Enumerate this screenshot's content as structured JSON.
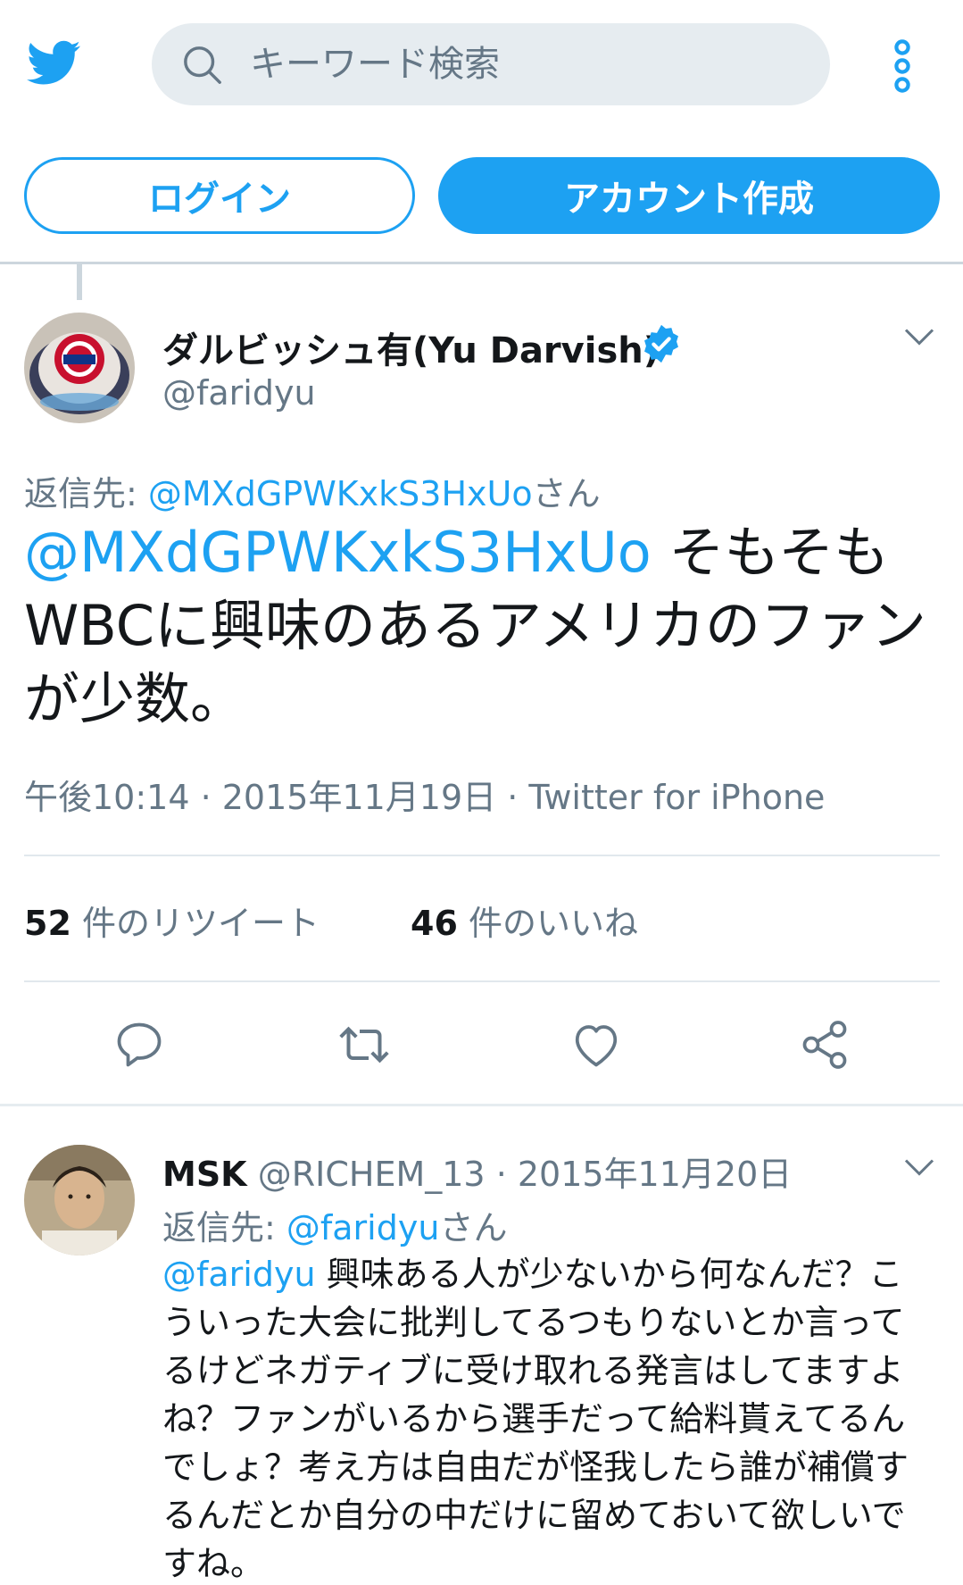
{
  "header": {
    "search_placeholder": "キーワード検索"
  },
  "auth": {
    "login_label": "ログイン",
    "signup_label": "アカウント作成"
  },
  "tweet": {
    "author_name": "ダルビッシュ有(Yu Darvish)",
    "author_handle": "@faridyu",
    "reply_to_prefix": "返信先: ",
    "reply_to_handle": "@MXdGPWKxkS3HxUo",
    "reply_to_suffix": "さん",
    "mention": "@MXdGPWKxkS3HxUo",
    "body": " そもそもWBCに興味のあるアメリカのファンが少数。",
    "timestamp": "午後10:14 · 2015年11月19日 · Twitter for iPhone",
    "retweet_count": "52",
    "retweet_label": " 件のリツイート",
    "like_count": "46",
    "like_label": " 件のいいね"
  },
  "reply": {
    "author_name": "MSK",
    "author_handle": "@RICHEM_13",
    "date": " · 2015年11月20日",
    "reply_to_prefix": "返信先: ",
    "reply_to_handle": "@faridyu",
    "reply_to_suffix": "さん",
    "mention": "@faridyu",
    "body": " 興味ある人が少ないから何なんだ？こういった大会に批判してるつもりないとか言ってるけどネガティブに受け取れる発言はしてますよね？ファンがいるから選手だって給料貰えてるんでしょ？考え方は自由だが怪我したら誰が補償するんだとか自分の中だけに留めておいて欲しいですね。"
  },
  "colors": {
    "brand_blue": "#1da1f2",
    "text_gray": "#657786",
    "text_dark": "#14171a"
  },
  "icons": [
    "twitter-bird-icon",
    "search-icon",
    "more-vertical-icon",
    "verified-badge-icon",
    "chevron-down-icon",
    "reply-icon",
    "retweet-icon",
    "like-icon",
    "share-icon"
  ]
}
